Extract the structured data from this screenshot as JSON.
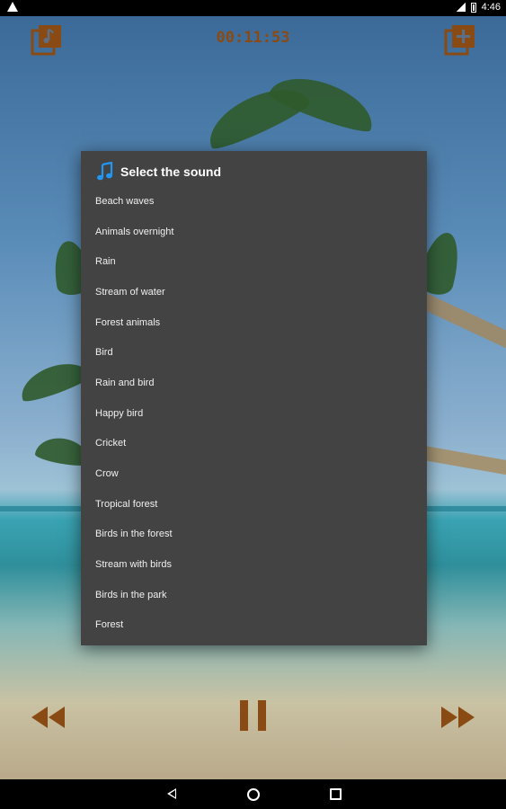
{
  "status_bar": {
    "time": "4:46"
  },
  "player": {
    "timer": "00:11:53"
  },
  "dialog": {
    "title": "Select the sound",
    "items": [
      "Beach waves",
      "Animals overnight",
      "Rain",
      "Stream of water",
      "Forest animals",
      "Bird",
      "Rain and bird",
      "Happy bird",
      "Cricket",
      "Crow",
      "Tropical forest",
      "Birds in the forest",
      "Stream with birds",
      "Birds in the park",
      "Forest"
    ]
  },
  "colors": {
    "accent": "#8a4a14",
    "dialog_bg": "#434343",
    "note_icon": "#2196f3"
  },
  "icons": [
    "warning-icon",
    "signal-icon",
    "battery-icon",
    "music-library-icon",
    "add-playlist-icon",
    "rewind-icon",
    "pause-icon",
    "fast-forward-icon",
    "music-note-icon",
    "back-icon",
    "home-icon",
    "recents-icon"
  ]
}
